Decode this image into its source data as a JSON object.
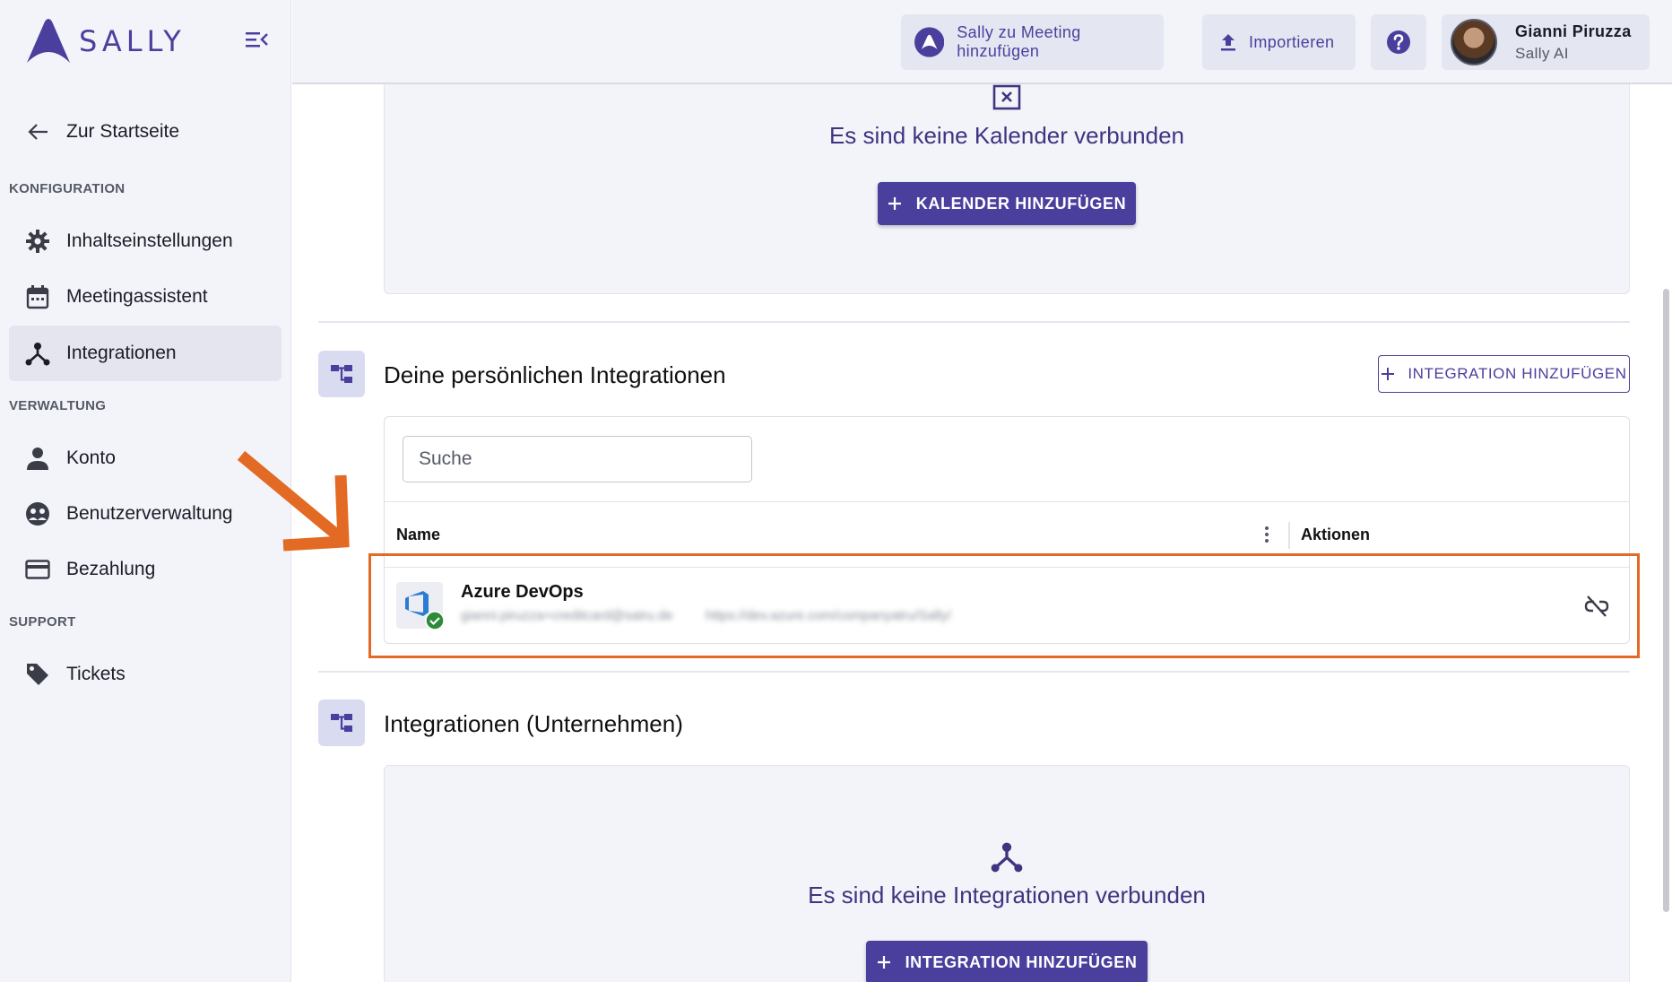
{
  "sidebar": {
    "logo_text": "SALLY",
    "back_label": "Zur Startseite",
    "sections": {
      "konfiguration": "KONFIGURATION",
      "verwaltung": "VERWALTUNG",
      "support": "SUPPORT"
    },
    "items": {
      "inhaltseinstellungen": "Inhaltseinstellungen",
      "meetingassistent": "Meetingassistent",
      "integrationen": "Integrationen",
      "konto": "Konto",
      "benutzerverwaltung": "Benutzerverwaltung",
      "bezahlung": "Bezahlung",
      "tickets": "Tickets"
    }
  },
  "topbar": {
    "add_to_meeting": "Sally zu Meeting hinzufügen",
    "import": "Importieren",
    "user_name": "Gianni Piruzza",
    "user_org": "Sally AI"
  },
  "calendar": {
    "empty_title": "Es sind keine Kalender verbunden",
    "add_button": "KALENDER HINZUFÜGEN"
  },
  "personal": {
    "title": "Deine persönlichen Integrationen",
    "add_button": "INTEGRATION HINZUFÜGEN",
    "search_placeholder": "Suche",
    "columns": {
      "name": "Name",
      "actions": "Aktionen"
    },
    "rows": [
      {
        "name": "Azure DevOps",
        "detail_email": "gianni.piruzza+creditcard@satru.de",
        "detail_url": "https://dev.azure.com/companyatru/Sally/"
      }
    ]
  },
  "company": {
    "title": "Integrationen (Unternehmen)",
    "empty_title": "Es sind keine Integrationen verbunden",
    "add_button": "INTEGRATION HINZUFÜGEN"
  },
  "colors": {
    "brand": "#4b3f9e",
    "annotation": "#e36a24",
    "success": "#2e8b3a"
  }
}
